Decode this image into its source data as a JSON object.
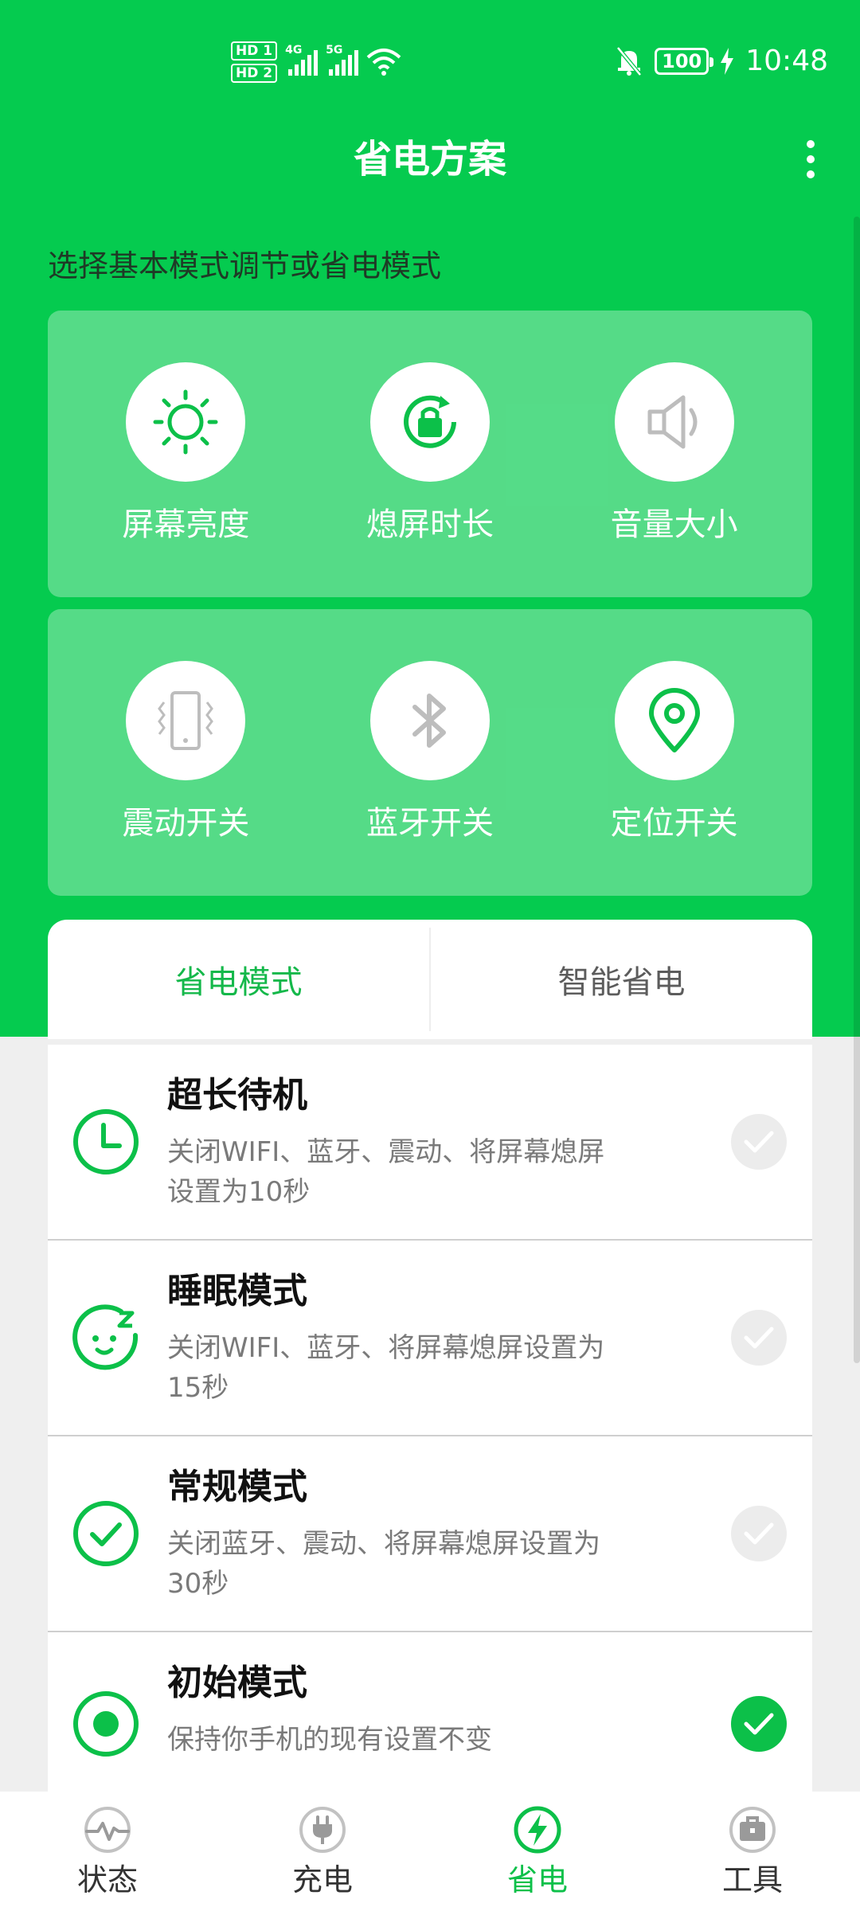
{
  "status_bar": {
    "hd1": "HD 1",
    "hd2": "HD 2",
    "net1": "4G",
    "net2": "5G",
    "battery": "100",
    "time": "10:48"
  },
  "header": {
    "title": "省电方案"
  },
  "subtitle": "选择基本模式调节或省电模式",
  "quick_settings": [
    {
      "label": "屏幕亮度",
      "icon": "sun-icon"
    },
    {
      "label": "熄屏时长",
      "icon": "screen-lock-icon"
    },
    {
      "label": "音量大小",
      "icon": "speaker-icon"
    },
    {
      "label": "震动开关",
      "icon": "vibrate-icon"
    },
    {
      "label": "蓝牙开关",
      "icon": "bluetooth-icon"
    },
    {
      "label": "定位开关",
      "icon": "location-icon"
    }
  ],
  "tabs": [
    {
      "label": "省电模式",
      "active": true
    },
    {
      "label": "智能省电",
      "active": false
    }
  ],
  "modes": [
    {
      "title": "超长待机",
      "desc": "关闭WIFI、蓝牙、震动、将屏幕熄屏设置为10秒",
      "icon": "clock-icon",
      "selected": false
    },
    {
      "title": "睡眠模式",
      "desc": "关闭WIFI、蓝牙、将屏幕熄屏设置为15秒",
      "icon": "sleep-face-icon",
      "selected": false
    },
    {
      "title": "常规模式",
      "desc": "关闭蓝牙、震动、将屏幕熄屏设置为30秒",
      "icon": "check-circle-icon",
      "selected": false
    },
    {
      "title": "初始模式",
      "desc": "保持你手机的现有设置不变",
      "icon": "radio-dot-icon",
      "selected": true
    }
  ],
  "nav": [
    {
      "label": "状态",
      "icon": "pulse-icon"
    },
    {
      "label": "充电",
      "icon": "plug-icon"
    },
    {
      "label": "省电",
      "icon": "bolt-icon",
      "active": true
    },
    {
      "label": "工具",
      "icon": "toolbox-icon"
    }
  ],
  "colors": {
    "primary_green": "#05cb4f",
    "accent_green": "#0cc049",
    "background": "#efefef"
  }
}
